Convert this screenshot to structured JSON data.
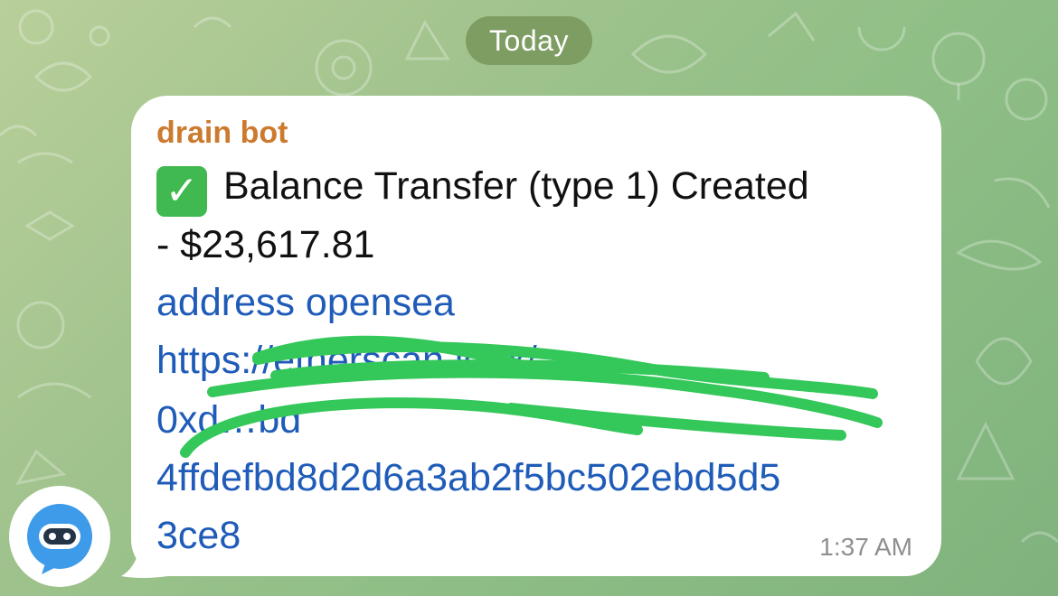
{
  "date_separator": "Today",
  "message": {
    "sender": "drain bot",
    "title_line": "Balance Transfer (type 1) Created",
    "amount_line": "- $23,617.81",
    "link_lines": [
      "address opensea",
      "https://etherscan.io/tx/",
      "0xd…bd",
      "4ffdefbd8d2d6a3ab2f5bc502ebd5d5",
      "3ce8"
    ],
    "time": "1:37 AM",
    "icon": "check-mark-emoji"
  },
  "avatar": {
    "icon": "robot-chat-icon"
  },
  "colors": {
    "sender": "#cc7a2e",
    "link": "#1f5bb8",
    "scribble": "#34c759",
    "bubble": "#ffffff"
  }
}
